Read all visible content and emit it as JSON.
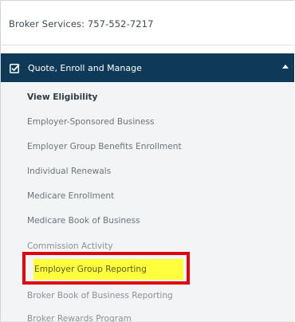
{
  "broker_services": {
    "text": "Broker Services: 757-552-7217"
  },
  "section": {
    "title": "Quote, Enroll and Manage",
    "icon": "checkbox-icon",
    "toggle_icon": "caret-up-icon"
  },
  "menu": {
    "items": [
      {
        "label": "View Eligibility"
      },
      {
        "label": "Employer-Sponsored Business"
      },
      {
        "label": "Employer Group Benefits Enrollment"
      },
      {
        "label": "Individual Renewals"
      },
      {
        "label": "Medicare Enrollment"
      },
      {
        "label": "Medicare Book of Business"
      },
      {
        "label": "Commission Activity"
      },
      {
        "label": "Employer Group Reporting"
      },
      {
        "label": "Broker Book of Business Reporting"
      },
      {
        "label": "Broker Rewards Program"
      }
    ]
  },
  "colors": {
    "header_bg": "#0e3a57",
    "highlight": "#ffff3c",
    "annotation_border": "#e0000e"
  }
}
